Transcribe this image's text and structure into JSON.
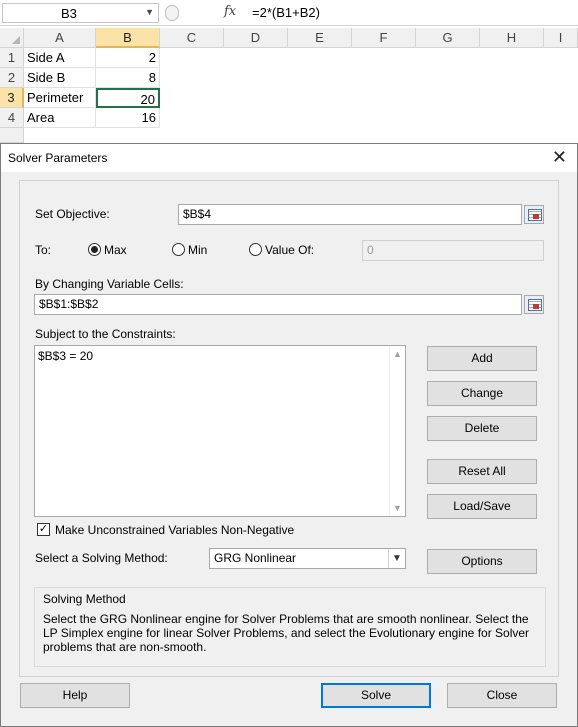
{
  "excel": {
    "name_box": "B3",
    "fx_label": "fx",
    "formula": "=2*(B1+B2)",
    "columns": [
      "A",
      "B",
      "C",
      "D",
      "E",
      "F",
      "G",
      "H",
      "I"
    ],
    "rows": [
      {
        "num": "1",
        "a": "Side A",
        "b": "2"
      },
      {
        "num": "2",
        "a": "Side B",
        "b": "8"
      },
      {
        "num": "3",
        "a": "Perimeter",
        "b": "20"
      },
      {
        "num": "4",
        "a": "Area",
        "b": "16"
      }
    ]
  },
  "dialog": {
    "title": "Solver Parameters",
    "set_objective_label": "Set Objective:",
    "objective_value": "$B$4",
    "to_label": "To:",
    "opt_max": "Max",
    "opt_min": "Min",
    "opt_value_of": "Value Of:",
    "value_of_field": "0",
    "changing_label": "By Changing Variable Cells:",
    "changing_value": "$B$1:$B$2",
    "constraints_label": "Subject to the Constraints:",
    "constraints": [
      "$B$3 = 20"
    ],
    "buttons": {
      "add": "Add",
      "change": "Change",
      "delete": "Delete",
      "reset_all": "Reset All",
      "load_save": "Load/Save",
      "options": "Options",
      "help": "Help",
      "solve": "Solve",
      "close": "Close"
    },
    "nonneg_label": "Make Unconstrained Variables Non-Negative",
    "method_label": "Select a Solving Method:",
    "method_value": "GRG Nonlinear",
    "solving_method_title": "Solving Method",
    "solving_method_desc": "Select the GRG Nonlinear engine for Solver Problems that are smooth nonlinear. Select the LP Simplex engine for linear Solver Problems, and select the Evolutionary engine for Solver problems that are non-smooth."
  }
}
